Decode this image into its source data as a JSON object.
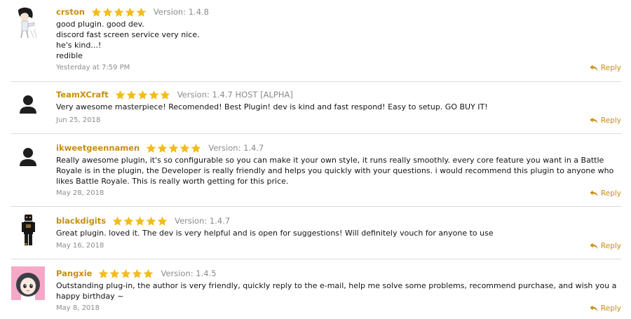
{
  "colors": {
    "username": "#c98e0f",
    "star": "#f2bc1b",
    "meta": "#8c8c8c",
    "divider": "#dcdcdc",
    "text": "#141414"
  },
  "reply_label": "Reply",
  "reviews": [
    {
      "username": "crston",
      "rating": 5,
      "version": "Version: 1.4.8",
      "lines": [
        "good plugin. good dev.",
        "discord fast screen service very nice.",
        "he's kind...!",
        "redible"
      ],
      "date": "Yesterday at 7:59 PM",
      "avatar": "anime-figure-avatar"
    },
    {
      "username": "TeamXCraft",
      "rating": 5,
      "version": "Version: 1.4.7 HOST [ALPHA]",
      "lines": [
        "Very awesome masterpiece! Recomended! Best Plugin! dev is kind and fast respond! Easy to setup. GO BUY IT!"
      ],
      "date": "Jun 25, 2018",
      "avatar": "default-user-avatar"
    },
    {
      "username": "ikweetgeennamen",
      "rating": 5,
      "version": "Version: 1.4.7",
      "text": "Really awesome plugin, it's so configurable so you can make it your own style, it runs really smoothly. every core feature you want in a Battle Royale is in the plugin, the Developer is really friendly and helps you quickly with your questions. i would recommend this plugin to anyone who likes Battle Royale. This is really worth getting for this price.",
      "date": "May 28, 2018",
      "avatar": "default-user-avatar"
    },
    {
      "username": "blackdigits",
      "rating": 5,
      "version": "Version: 1.4.7",
      "lines": [
        "Great plugin. loved it. The dev is very helpful and is open for suggestions! Will definitely vouch for anyone to use"
      ],
      "date": "May 16, 2018",
      "avatar": "figure-avatar"
    },
    {
      "username": "Pangxie",
      "rating": 5,
      "version": "Version: 1.4.5",
      "text": "Outstanding plug-in, the author is very friendly, quickly reply to the e-mail, help me solve some problems, recommend purchase, and wish you a happy birthday ~",
      "date": "May 8, 2018",
      "avatar": "anime-girl-avatar"
    }
  ]
}
